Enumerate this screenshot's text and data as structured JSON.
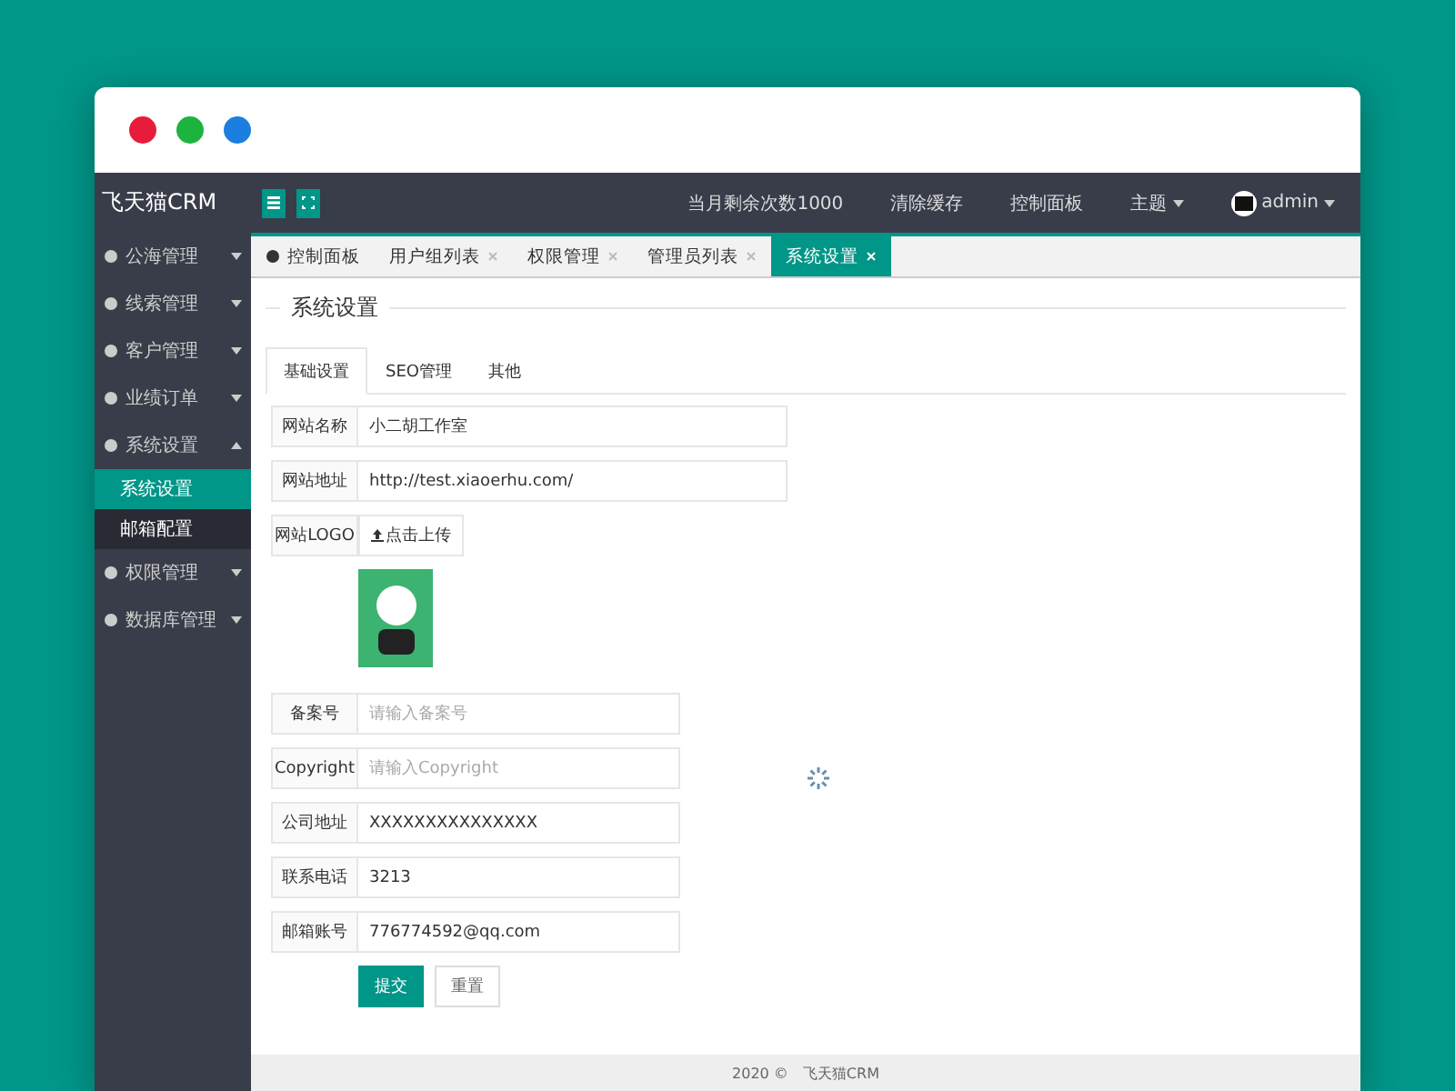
{
  "app": {
    "logo": "飞天猫CRM"
  },
  "header": {
    "links": [
      {
        "label": "当月剩余次数1000",
        "dropdown": false
      },
      {
        "label": "清除缓存",
        "dropdown": false
      },
      {
        "label": "控制面板",
        "dropdown": false
      },
      {
        "label": "主题",
        "dropdown": true
      }
    ],
    "user": {
      "name": "admin"
    }
  },
  "sidebar": {
    "items": [
      {
        "label": "公海管理",
        "expanded": false
      },
      {
        "label": "线索管理",
        "expanded": false
      },
      {
        "label": "客户管理",
        "expanded": false
      },
      {
        "label": "业绩订单",
        "expanded": false
      },
      {
        "label": "系统设置",
        "expanded": true,
        "children": [
          {
            "label": "系统设置",
            "selected": true
          },
          {
            "label": "邮箱配置",
            "selected": false
          }
        ]
      },
      {
        "label": "权限管理",
        "expanded": false
      },
      {
        "label": "数据库管理",
        "expanded": false
      }
    ]
  },
  "tabs": [
    {
      "label": "控制面板",
      "selected": false,
      "closable": false
    },
    {
      "label": "用户组列表",
      "selected": false,
      "closable": true
    },
    {
      "label": "权限管理",
      "selected": false,
      "closable": true
    },
    {
      "label": "管理员列表",
      "selected": false,
      "closable": true
    },
    {
      "label": "系统设置",
      "selected": true,
      "closable": true
    }
  ],
  "page": {
    "title": "系统设置",
    "subtabs": [
      {
        "label": "基础设置",
        "selected": true
      },
      {
        "label": "SEO管理",
        "selected": false
      },
      {
        "label": "其他",
        "selected": false
      }
    ],
    "site_fields": [
      {
        "label": "网站名称",
        "value": "小二胡工作室"
      },
      {
        "label": "网站地址",
        "value": "http://test.xiaoerhu.com/"
      }
    ],
    "logo_field": {
      "label": "网站LOGO",
      "button": "点击上传"
    },
    "contact_fields": [
      {
        "label": "备案号",
        "placeholder": "请输入备案号"
      },
      {
        "label": "Copyright",
        "placeholder": "请输入Copyright"
      },
      {
        "label": "公司地址",
        "value": "XXXXXXXXXXXXXXX"
      },
      {
        "label": "联系电话",
        "value": "3213"
      },
      {
        "label": "邮箱账号",
        "value": "776774592@qq.com"
      }
    ],
    "buttons": {
      "submit": "提交",
      "reset": "重置"
    }
  },
  "footer": {
    "year": "2020 ©",
    "name": "飞天猫CRM"
  }
}
